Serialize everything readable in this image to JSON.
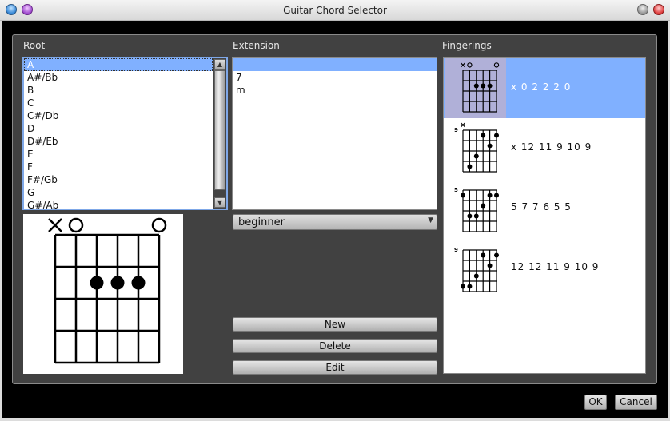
{
  "window": {
    "title": "Guitar Chord Selector"
  },
  "root": {
    "label": "Root",
    "items": [
      "A",
      "A#/Bb",
      "B",
      "C",
      "C#/Db",
      "D",
      "D#/Eb",
      "E",
      "F",
      "F#/Gb",
      "G",
      "G#/Ab"
    ],
    "selected_index": 0
  },
  "extension": {
    "label": "Extension",
    "items": [
      "",
      "7",
      "m"
    ],
    "selected_index": 0
  },
  "level": {
    "selected": "beginner"
  },
  "buttons": {
    "new": "New",
    "delete": "Delete",
    "edit": "Edit",
    "ok": "OK",
    "cancel": "Cancel"
  },
  "selected_chord": {
    "frets": [
      "x",
      "0",
      "2",
      "2",
      "2",
      "0"
    ],
    "base_fret": null
  },
  "fingerings": {
    "label": "Fingerings",
    "selected_index": 0,
    "items": [
      {
        "text": "x 0 2 2 2 0",
        "frets": [
          "x",
          "0",
          "2",
          "2",
          "2",
          "0"
        ],
        "base_fret": null
      },
      {
        "text": "x 12 11 9 10 9",
        "frets": [
          "x",
          "12",
          "11",
          "9",
          "10",
          "9"
        ],
        "base_fret": "9"
      },
      {
        "text": "5 7 7 6 5 5",
        "frets": [
          "5",
          "7",
          "7",
          "6",
          "5",
          "5"
        ],
        "base_fret": "5"
      },
      {
        "text": "12 12 11 9 10 9",
        "frets": [
          "12",
          "12",
          "11",
          "9",
          "10",
          "9"
        ],
        "base_fret": "9"
      }
    ]
  }
}
